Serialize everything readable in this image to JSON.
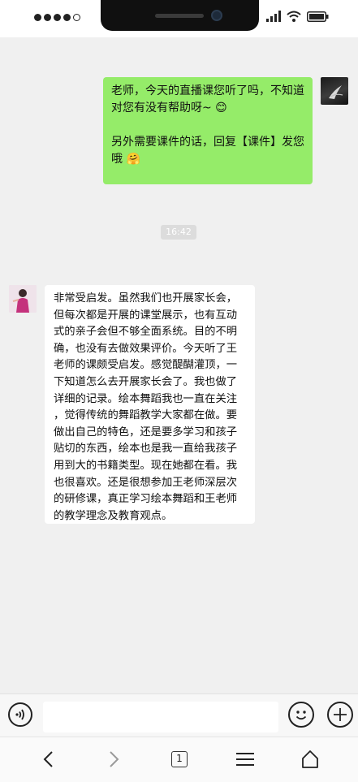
{
  "status_bar": {
    "signal_dots_filled": 4,
    "signal_dots_total": 5
  },
  "chat": {
    "messages": [
      {
        "side": "right",
        "lines": [
          "老师，今天的直播课您听了吗，不知道",
          "对您有没有帮助呀~ 😊",
          "",
          "另外需要课件的话，回复【课件】发您",
          "哦 🤗"
        ]
      },
      {
        "timestamp": "16:42"
      },
      {
        "side": "left",
        "lines": [
          "非常受启发。虽然我们也开展家长会，",
          "但每次都是开展的课堂展示，也有互动",
          "式的亲子会但不够全面系统。目的不明",
          "确，也没有去做效果评价。今天听了王",
          "老师的课颇受启发。感觉醍醐灌顶，一",
          "下知道怎么去开展家长会了。我也做了",
          "详细的记录。绘本舞蹈我也一直在关注",
          "，觉得传统的舞蹈教学大家都在做。要",
          "做出自己的特色，还是要多学习和孩子",
          "贴切的东西，绘本也是我一直给我孩子",
          "用到大的书籍类型。现在她都在看。我",
          "也很喜欢。还是很想参加王老师深层次",
          "的研修课，真正学习绘本舞蹈和王老师",
          "的教学理念及教育观点。"
        ]
      }
    ]
  },
  "input_bar": {
    "voice_icon": "voice-icon",
    "emoji_icon": "emoji-icon",
    "plus_icon": "plus-icon"
  },
  "nav": {
    "tab_count": "1"
  },
  "colors": {
    "sent_bubble": "#95ec69",
    "chat_bg": "#f0f0f0"
  }
}
